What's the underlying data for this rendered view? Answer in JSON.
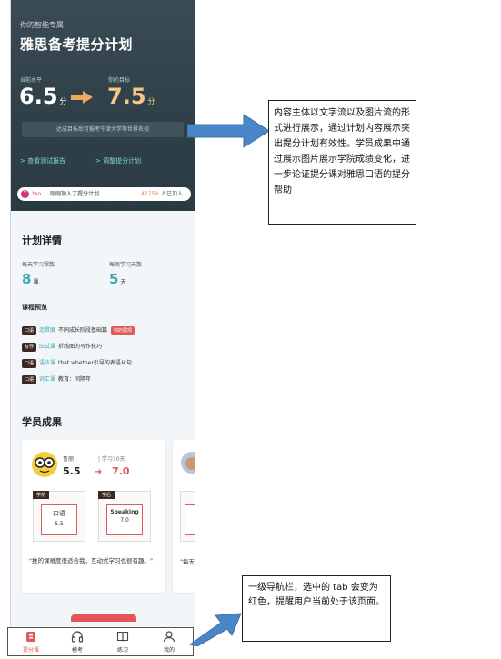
{
  "hero": {
    "tagline": "你的智能专属",
    "title": "雅思备考提分计划",
    "current_label": "当前水平",
    "goal_label": "你的目标",
    "current_score": "6.5",
    "goal_score": "7.5",
    "score_unit": "分",
    "target_text": "达成目标后可报考牛津大学等世界名校",
    "link_report": "> 查看测试报告",
    "link_adjust": "> 调整提分计划"
  },
  "notice": {
    "avatar": "Y",
    "name": "Yao",
    "message": "刚刚加入了提分计划",
    "count": "42759",
    "suffix": "人已加入"
  },
  "plan": {
    "title": "计划详情",
    "daily_label": "每天学习课数",
    "daily_value": "8",
    "daily_unit": "课",
    "weekly_label": "每周学习天数",
    "weekly_value": "5",
    "weekly_unit": "天"
  },
  "preview": {
    "title": "课程预览",
    "items": [
      {
        "tag": "口语",
        "type": "连贯度",
        "desc": "不同成长阶段基础篇",
        "badge": "你的弱项"
      },
      {
        "tag": "写作",
        "type": "应试课",
        "desc": "折线图的写作技巧",
        "badge": ""
      },
      {
        "tag": "口语",
        "type": "语法课",
        "desc": "that whether引导的表语从句",
        "badge": ""
      },
      {
        "tag": "口语",
        "type": "词汇课",
        "desc": "教育：间隔年",
        "badge": ""
      }
    ]
  },
  "results": {
    "title": "学员成果",
    "card": {
      "name": "鲁丽",
      "days": "| 学习30天",
      "from": "5.5",
      "to": "7.0",
      "before_tag": "学前",
      "after_tag": "学后",
      "before_label": "口语",
      "before_score": "5.5",
      "after_label": "Speaking",
      "after_score": "7.0",
      "quote": "\"推的课难度很适合我，互动式学习也很有趣。\""
    },
    "card2_quote": "\"每天"
  },
  "tabbar": [
    {
      "label": "提分课",
      "icon": "lesson-icon",
      "active": true
    },
    {
      "label": "模考",
      "icon": "headphones-icon",
      "active": false
    },
    {
      "label": "练习",
      "icon": "book-icon",
      "active": false
    },
    {
      "label": "我的",
      "icon": "person-icon",
      "active": false
    }
  ],
  "annotations": {
    "note1": "内容主体以文字流以及图片流的形式进行展示，通过计划内容展示突出提分计划有效性。学员成果中通过展示图片展示学院成绩变化，进一步论证提分课对雅思口语的提分帮助",
    "note2": "一级导航栏，选中的 tab 会变为红色，提醒用户当前处于该页面。"
  },
  "colors": {
    "accent": "#e05a5a",
    "teal": "#3aa6b3",
    "hero_bg": "#34464e",
    "goal": "#f5c58a",
    "callout": "#4a86c8"
  }
}
